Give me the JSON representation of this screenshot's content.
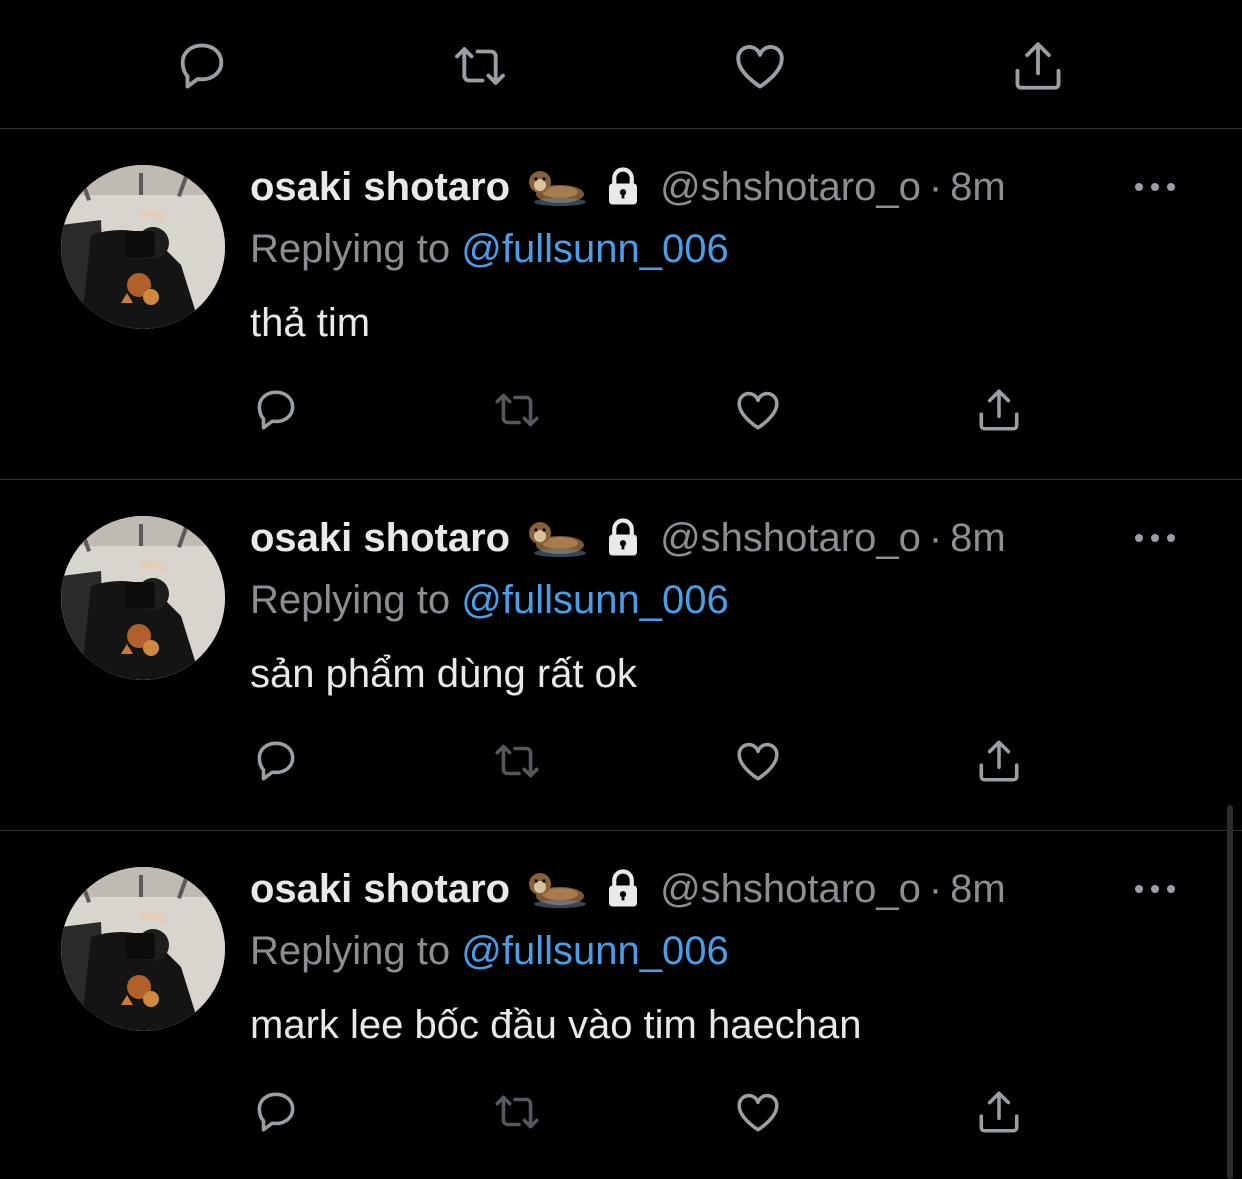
{
  "top_actions": [
    {
      "name": "reply-icon",
      "color": "#9a9fa4"
    },
    {
      "name": "retweet-icon",
      "color": "#9a9fa4"
    },
    {
      "name": "like-icon",
      "color": "#9a9fa4"
    },
    {
      "name": "share-icon",
      "color": "#9a9fa4"
    }
  ],
  "tweets": [
    {
      "author_name": "osaki shotaro",
      "emoji_icon": "otter-emoji-icon",
      "protected_icon": "lock-icon",
      "handle": "@shshotaro_o",
      "separator": "·",
      "time": "8m",
      "replying_prefix": "Replying to ",
      "replying_to": "@fullsunn_006",
      "text": "thả tim"
    },
    {
      "author_name": "osaki shotaro",
      "emoji_icon": "otter-emoji-icon",
      "protected_icon": "lock-icon",
      "handle": "@shshotaro_o",
      "separator": "·",
      "time": "8m",
      "replying_prefix": "Replying to ",
      "replying_to": "@fullsunn_006",
      "text": "sản phẩm dùng rất ok"
    },
    {
      "author_name": "osaki shotaro",
      "emoji_icon": "otter-emoji-icon",
      "protected_icon": "lock-icon",
      "handle": "@shshotaro_o",
      "separator": "·",
      "time": "8m",
      "replying_prefix": "Replying to ",
      "replying_to": "@fullsunn_006",
      "text": "mark lee bốc đầu vào tim haechan"
    }
  ],
  "colors": {
    "background": "#000000",
    "primary_text": "#e7e9ea",
    "secondary_text": "#8b8f94",
    "mention": "#4a9ee8",
    "divider": "#2f3336"
  }
}
